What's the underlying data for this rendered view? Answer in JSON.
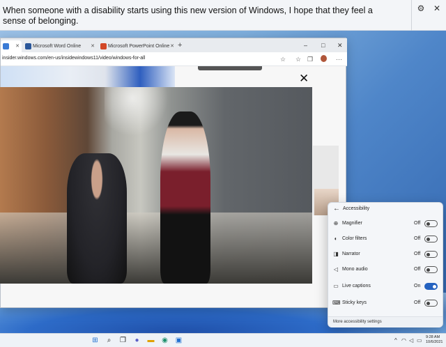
{
  "caption": {
    "text": "When someone with a disability starts using this new version of Windows, I hope that they feel a sense of belonging.",
    "settings_icon": "gear-icon",
    "close_icon": "close-icon"
  },
  "browser": {
    "tabs": [
      {
        "label": "",
        "icon": "windows-icon",
        "active": true
      },
      {
        "label": "Microsoft Word Online",
        "icon": "word-icon",
        "active": false
      },
      {
        "label": "Microsoft PowerPoint Online",
        "icon": "powerpoint-icon",
        "active": false
      }
    ],
    "new_tab": "+",
    "url": "insider.windows.com/en-us/insidewindows11/video/windows-for-all",
    "window_controls": [
      "–",
      "□",
      "✕"
    ]
  },
  "video": {
    "close_label": "✕"
  },
  "accessibility": {
    "title": "Accessibility",
    "back": "←",
    "items": [
      {
        "label": "Magnifier",
        "state": "Off",
        "on": false,
        "icon": "magnifier-icon"
      },
      {
        "label": "Color filters",
        "state": "Off",
        "on": false,
        "icon": "color-filters-icon"
      },
      {
        "label": "Narrator",
        "state": "Off",
        "on": false,
        "icon": "narrator-icon"
      },
      {
        "label": "Mono audio",
        "state": "Off",
        "on": false,
        "icon": "mono-audio-icon"
      },
      {
        "label": "Live captions",
        "state": "On",
        "on": true,
        "icon": "live-captions-icon"
      },
      {
        "label": "Sticky keys",
        "state": "Off",
        "on": false,
        "icon": "sticky-keys-icon"
      }
    ],
    "footer": "More accessibility settings"
  },
  "taskbar": {
    "time": "9:28 AM",
    "date": "10/6/2021"
  },
  "colors": {
    "accent": "#2462c0",
    "caption_bg": "#f3f5f8",
    "flyout_bg": "#f4f6f9"
  }
}
